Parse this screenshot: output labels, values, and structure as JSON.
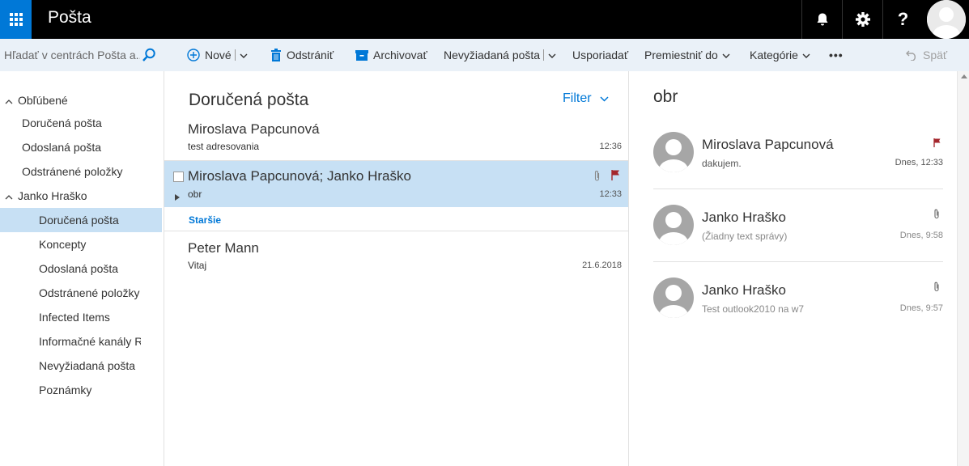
{
  "app": {
    "title": "Pošta"
  },
  "topbar": {
    "icons": [
      "waffle-icon",
      "bell-icon",
      "gear-icon",
      "help-icon",
      "avatar"
    ]
  },
  "search": {
    "placeholder": "Hľadať v centrách Pošta a..."
  },
  "toolbar": {
    "new_label": "Nové",
    "delete_label": "Odstrániť",
    "archive_label": "Archivovať",
    "junk_label": "Nevyžiadaná pošta",
    "sweep_label": "Usporiadať",
    "move_label": "Premiestniť do",
    "categories_label": "Kategórie",
    "more_label": "•••",
    "undo_label": "Späť"
  },
  "sidebar": {
    "favorites_label": "Obľúbené",
    "favorites": [
      {
        "label": "Doručená pošta"
      },
      {
        "label": "Odoslaná pošta"
      },
      {
        "label": "Odstránené položky"
      }
    ],
    "account_label": "Janko Hraško",
    "folders": [
      {
        "label": "Doručená pošta",
        "selected": true
      },
      {
        "label": "Koncepty"
      },
      {
        "label": "Odoslaná pošta"
      },
      {
        "label": "Odstránené položky"
      },
      {
        "label": "Infected Items"
      },
      {
        "label": "Informačné kanály RSS"
      },
      {
        "label": "Nevyžiadaná pošta"
      },
      {
        "label": "Poznámky"
      }
    ]
  },
  "message_list": {
    "title": "Doručená pošta",
    "filter_label": "Filter",
    "older_label": "Staršie",
    "messages": [
      {
        "sender": "Miroslava Papcunová",
        "subject": "test adresovania",
        "time": "12:36"
      },
      {
        "sender": "Miroslava Papcunová; Janko Hraško",
        "subject": "obr",
        "time": "12:33",
        "attachment": true,
        "flagged": true,
        "selected": true
      },
      {
        "sender": "Peter Mann",
        "subject": "Vitaj",
        "time": "21.6.2018"
      }
    ]
  },
  "reading_pane": {
    "subject": "obr",
    "items": [
      {
        "sender": "Miroslava Papcunová",
        "preview": "dakujem.",
        "time": "Dnes, 12:33",
        "icon": "flag-icon"
      },
      {
        "sender": "Janko Hraško",
        "preview": "(Žiadny text správy)",
        "time": "Dnes, 9:58",
        "icon": "paperclip-icon"
      },
      {
        "sender": "Janko Hraško",
        "preview": "Test outlook2010 na w7",
        "time": "Dnes, 9:57",
        "icon": "paperclip-icon"
      }
    ]
  },
  "colors": {
    "accent": "#0078d7",
    "topbar": "#000000",
    "command_bar": "#eaf1f8",
    "selected": "#c7e0f4",
    "flag": "#a4262c"
  }
}
